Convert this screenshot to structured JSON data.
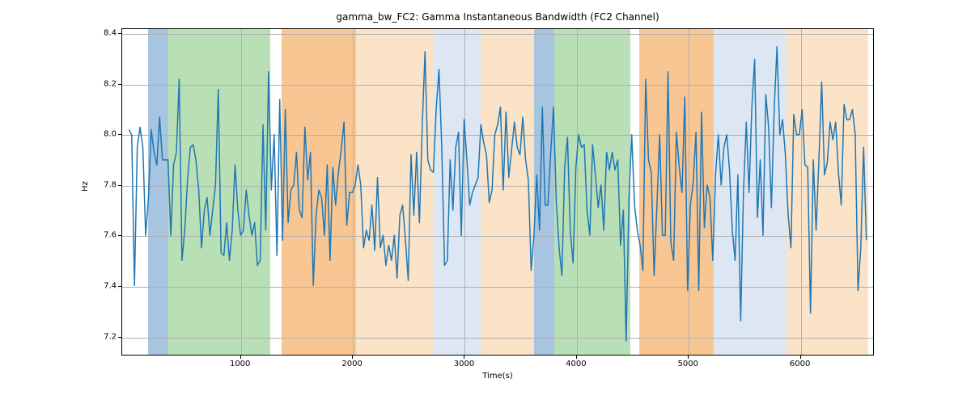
{
  "chart_data": {
    "type": "line",
    "title": "gamma_bw_FC2: Gamma Instantaneous Bandwidth (FC2 Channel)",
    "xlabel": "Time(s)",
    "ylabel": "Hz",
    "xlim": [
      -60,
      6660
    ],
    "ylim": [
      7.125,
      8.42
    ],
    "x_ticks": [
      1000,
      2000,
      3000,
      4000,
      5000,
      6000
    ],
    "y_ticks": [
      7.2,
      7.4,
      7.6,
      7.8,
      8.0,
      8.2,
      8.4
    ],
    "line_color": "#1f77b4",
    "bands": [
      {
        "x0": 170,
        "x1": 350,
        "color": "#a7c4e0"
      },
      {
        "x0": 350,
        "x1": 1260,
        "color": "#b9dfb6"
      },
      {
        "x0": 1360,
        "x1": 2030,
        "color": "#f8c693"
      },
      {
        "x0": 2030,
        "x1": 2720,
        "color": "#fbe3c8"
      },
      {
        "x0": 2720,
        "x1": 3140,
        "color": "#dde7f3"
      },
      {
        "x0": 3140,
        "x1": 3620,
        "color": "#fbe3c8"
      },
      {
        "x0": 3620,
        "x1": 3800,
        "color": "#a7c4e0"
      },
      {
        "x0": 3800,
        "x1": 4480,
        "color": "#b9dfb6"
      },
      {
        "x0": 4560,
        "x1": 5220,
        "color": "#f8c693"
      },
      {
        "x0": 5220,
        "x1": 5870,
        "color": "#dde7f3"
      },
      {
        "x0": 5870,
        "x1": 5940,
        "color": "#fbe3c8"
      },
      {
        "x0": 5940,
        "x1": 6600,
        "color": "#fbe3c8"
      }
    ],
    "x": [
      0,
      25,
      50,
      75,
      100,
      125,
      150,
      175,
      200,
      225,
      250,
      275,
      300,
      325,
      350,
      375,
      400,
      425,
      450,
      475,
      500,
      525,
      550,
      575,
      600,
      625,
      650,
      675,
      700,
      725,
      750,
      775,
      800,
      825,
      850,
      875,
      900,
      925,
      950,
      975,
      1000,
      1025,
      1050,
      1075,
      1100,
      1125,
      1150,
      1175,
      1200,
      1225,
      1250,
      1275,
      1300,
      1325,
      1350,
      1375,
      1400,
      1425,
      1450,
      1475,
      1500,
      1525,
      1550,
      1575,
      1600,
      1625,
      1650,
      1675,
      1700,
      1725,
      1750,
      1775,
      1800,
      1825,
      1850,
      1875,
      1900,
      1925,
      1950,
      1975,
      2000,
      2025,
      2050,
      2075,
      2100,
      2125,
      2150,
      2175,
      2200,
      2225,
      2250,
      2275,
      2300,
      2325,
      2350,
      2375,
      2400,
      2425,
      2450,
      2475,
      2500,
      2525,
      2550,
      2575,
      2600,
      2625,
      2650,
      2675,
      2700,
      2725,
      2750,
      2775,
      2800,
      2825,
      2850,
      2875,
      2900,
      2925,
      2950,
      2975,
      3000,
      3025,
      3050,
      3075,
      3100,
      3125,
      3150,
      3175,
      3200,
      3225,
      3250,
      3275,
      3300,
      3325,
      3350,
      3375,
      3400,
      3425,
      3450,
      3475,
      3500,
      3525,
      3550,
      3575,
      3600,
      3625,
      3650,
      3675,
      3700,
      3725,
      3750,
      3775,
      3800,
      3825,
      3850,
      3875,
      3900,
      3925,
      3950,
      3975,
      4000,
      4025,
      4050,
      4075,
      4100,
      4125,
      4150,
      4175,
      4200,
      4225,
      4250,
      4275,
      4300,
      4325,
      4350,
      4375,
      4400,
      4425,
      4450,
      4475,
      4500,
      4525,
      4550,
      4575,
      4600,
      4625,
      4650,
      4675,
      4700,
      4725,
      4750,
      4775,
      4800,
      4825,
      4850,
      4875,
      4900,
      4925,
      4950,
      4975,
      5000,
      5025,
      5050,
      5075,
      5100,
      5125,
      5150,
      5175,
      5200,
      5225,
      5250,
      5275,
      5300,
      5325,
      5350,
      5375,
      5400,
      5425,
      5450,
      5475,
      5500,
      5525,
      5550,
      5575,
      5600,
      5625,
      5650,
      5675,
      5700,
      5725,
      5750,
      5775,
      5800,
      5825,
      5850,
      5875,
      5900,
      5925,
      5950,
      5975,
      6000,
      6025,
      6050,
      6075,
      6100,
      6125,
      6150,
      6175,
      6200,
      6225,
      6250,
      6275,
      6300,
      6325,
      6350,
      6375,
      6400,
      6425,
      6450,
      6475,
      6500,
      6525,
      6550,
      6575,
      6600
    ],
    "y": [
      8.02,
      8.0,
      7.4,
      7.95,
      8.03,
      7.95,
      7.6,
      7.75,
      8.02,
      7.93,
      7.88,
      8.07,
      7.9,
      7.9,
      7.9,
      7.6,
      7.88,
      7.93,
      8.22,
      7.5,
      7.62,
      7.82,
      7.95,
      7.96,
      7.9,
      7.78,
      7.55,
      7.7,
      7.75,
      7.6,
      7.7,
      7.8,
      8.18,
      7.53,
      7.52,
      7.65,
      7.5,
      7.62,
      7.88,
      7.7,
      7.6,
      7.62,
      7.78,
      7.68,
      7.6,
      7.65,
      7.48,
      7.5,
      8.04,
      7.62,
      8.25,
      7.78,
      8.0,
      7.52,
      8.14,
      7.58,
      8.1,
      7.65,
      7.78,
      7.8,
      7.93,
      7.7,
      7.67,
      8.03,
      7.82,
      7.93,
      7.4,
      7.68,
      7.78,
      7.75,
      7.6,
      7.88,
      7.5,
      7.87,
      7.72,
      7.85,
      7.94,
      8.05,
      7.64,
      7.77,
      7.77,
      7.8,
      7.88,
      7.8,
      7.55,
      7.62,
      7.58,
      7.72,
      7.54,
      7.83,
      7.55,
      7.6,
      7.48,
      7.56,
      7.5,
      7.6,
      7.43,
      7.68,
      7.72,
      7.58,
      7.42,
      7.92,
      7.68,
      7.93,
      7.65,
      8.03,
      8.33,
      7.9,
      7.86,
      7.85,
      8.1,
      8.26,
      7.95,
      7.48,
      7.5,
      7.9,
      7.7,
      7.95,
      8.01,
      7.6,
      8.06,
      7.9,
      7.72,
      7.77,
      7.8,
      7.83,
      8.04,
      7.97,
      7.92,
      7.73,
      7.78,
      8.0,
      8.04,
      8.11,
      7.78,
      8.09,
      7.83,
      7.94,
      8.05,
      7.95,
      7.92,
      8.07,
      7.9,
      7.82,
      7.46,
      7.6,
      7.84,
      7.62,
      8.11,
      7.72,
      7.72,
      7.93,
      8.11,
      7.73,
      7.55,
      7.44,
      7.87,
      7.99,
      7.62,
      7.49,
      7.87,
      8.0,
      7.95,
      7.96,
      7.7,
      7.6,
      7.96,
      7.84,
      7.71,
      7.8,
      7.62,
      7.93,
      7.86,
      7.93,
      7.86,
      7.9,
      7.56,
      7.7,
      7.18,
      7.74,
      8.0,
      7.72,
      7.62,
      7.56,
      7.46,
      8.22,
      7.9,
      7.85,
      7.44,
      7.71,
      8.0,
      7.6,
      7.6,
      8.25,
      7.57,
      7.5,
      8.01,
      7.87,
      7.77,
      8.15,
      7.38,
      7.72,
      7.81,
      8.01,
      7.38,
      8.09,
      7.63,
      7.8,
      7.75,
      7.5,
      7.84,
      8.0,
      7.8,
      7.95,
      8.0,
      7.86,
      7.62,
      7.5,
      7.84,
      7.26,
      7.77,
      8.05,
      7.77,
      8.11,
      8.3,
      7.67,
      7.9,
      7.6,
      8.16,
      8.03,
      7.71,
      8.1,
      8.35,
      8.0,
      8.06,
      7.92,
      7.68,
      7.55,
      8.08,
      8.0,
      8.0,
      8.1,
      7.88,
      7.87,
      7.29,
      7.9,
      7.62,
      7.9,
      8.21,
      7.84,
      7.89,
      8.05,
      7.98,
      8.05,
      7.85,
      7.72,
      8.12,
      8.06,
      8.06,
      8.1,
      8.0,
      7.38,
      7.55,
      7.95,
      7.58
    ]
  },
  "layout": {
    "axes_left": 150,
    "axes_top": 35,
    "axes_width": 930,
    "axes_height": 405
  }
}
